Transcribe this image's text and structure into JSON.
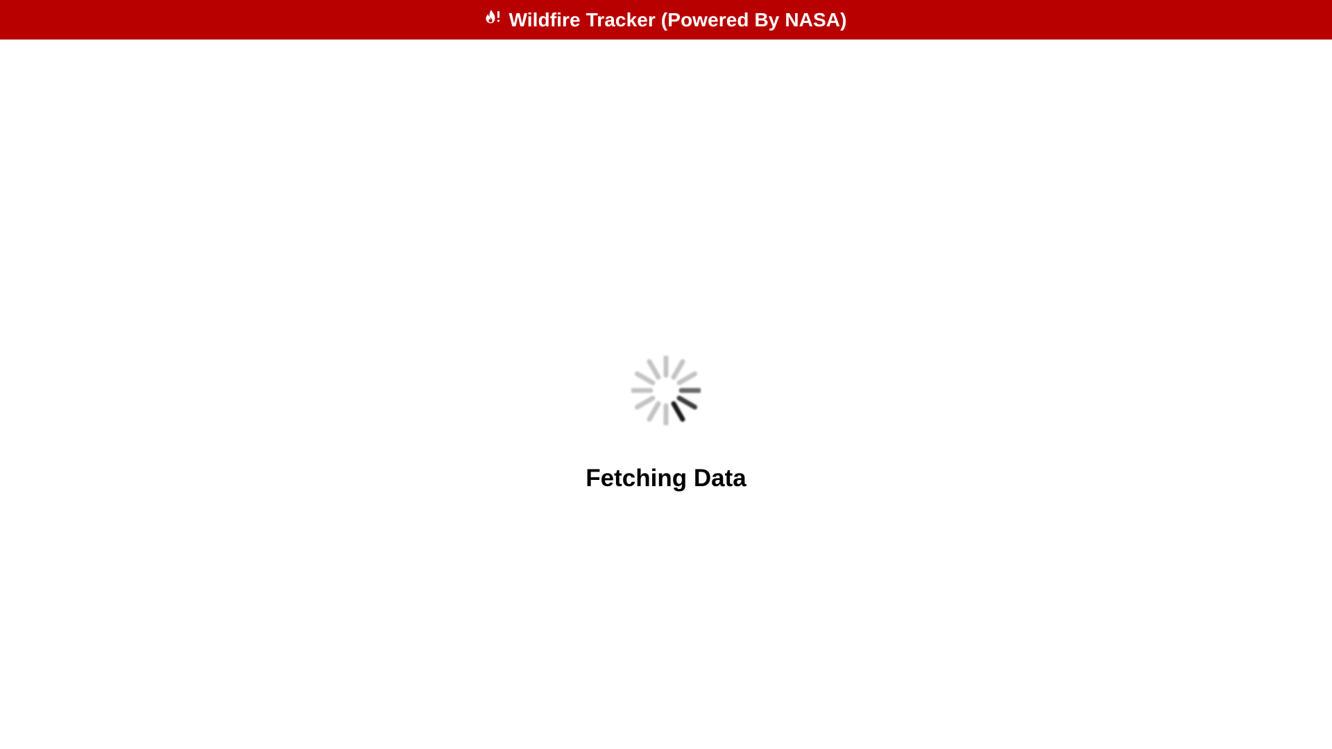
{
  "header": {
    "icon": "fire-alert-icon",
    "title": "Wildfire Tracker (Powered By NASA)",
    "background_color": "#b90000",
    "text_color": "#ffffff"
  },
  "loader": {
    "icon": "spinner-icon",
    "message": "Fetching Data"
  }
}
